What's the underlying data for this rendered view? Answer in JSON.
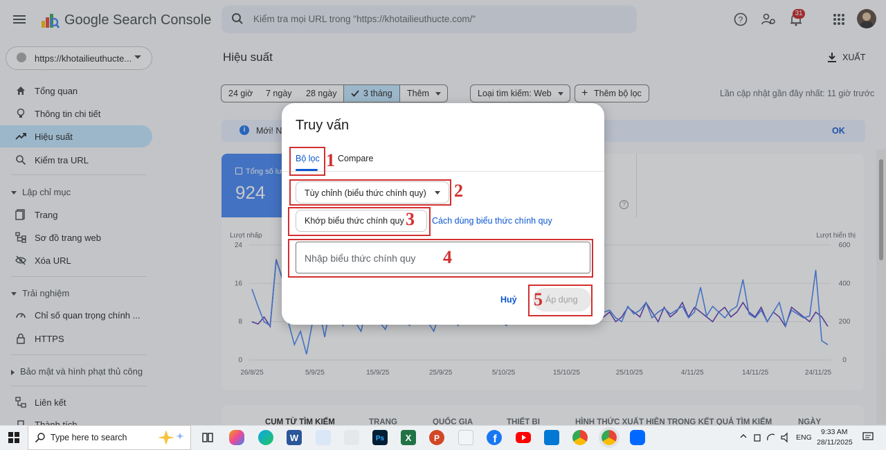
{
  "header": {
    "app_title": "Google Search Console",
    "search_placeholder": "Kiểm tra mọi URL trong \"https://khotailieuthucte.com/\"",
    "notifications_count": "31"
  },
  "sidebar": {
    "property": "https://khotailieuthucte...",
    "items_top": [
      {
        "label": "Tổng quan",
        "icon": "home-icon"
      },
      {
        "label": "Thông tin chi tiết",
        "icon": "lightbulb-icon"
      },
      {
        "label": "Hiệu suất",
        "icon": "trend-icon",
        "active": true
      },
      {
        "label": "Kiểm tra URL",
        "icon": "search-icon"
      }
    ],
    "section_index": "Lập chỉ mục",
    "items_index": [
      {
        "label": "Trang",
        "icon": "pages-icon"
      },
      {
        "label": "Sơ đồ trang web",
        "icon": "sitemap-icon"
      },
      {
        "label": "Xóa URL",
        "icon": "eye-off-icon"
      }
    ],
    "section_experience": "Trải nghiệm",
    "items_experience": [
      {
        "label": "Chỉ số quan trọng chính ...",
        "icon": "gauge-icon"
      },
      {
        "label": "HTTPS",
        "icon": "lock-icon"
      }
    ],
    "section_security": "Bảo mật và hình phạt thủ công",
    "items_links": [
      {
        "label": "Liên kết",
        "icon": "link-icon"
      },
      {
        "label": "Thành tích",
        "icon": "trophy-icon"
      }
    ]
  },
  "main": {
    "title": "Hiệu suất",
    "export_label": "XUẤT",
    "chips": [
      "24 giờ",
      "7 ngày",
      "28 ngày",
      "3 tháng",
      "Thêm",
      "Loại tìm kiếm: Web",
      "Thêm bộ lọc"
    ],
    "last_update": "Lần cập nhật gần đây nhất: 11 giờ trước",
    "banner_text": "Mới! N",
    "banner_ok": "OK",
    "metric_clicks_label": "Tổng số lư",
    "metric_clicks_value": "924",
    "table_tabs": [
      "CỤM TỪ TÌM KIẾM",
      "TRANG",
      "QUỐC GIA",
      "THIẾT BỊ",
      "HÌNH THỨC XUẤT HIỆN TRONG KẾT QUẢ TÌM KIẾM",
      "NGÀY"
    ]
  },
  "chart_data": {
    "type": "line",
    "ylabel_left": "Lượt nhấp",
    "ylabel_right": "Lượt hiển thị",
    "yticks_left": [
      "24",
      "16",
      "8",
      "0"
    ],
    "yticks_right": [
      "600",
      "400",
      "200",
      "0"
    ],
    "ylim_left": [
      0,
      24
    ],
    "ylim_right": [
      0,
      600
    ],
    "xticks": [
      "26/8/25",
      "5/9/25",
      "15/9/25",
      "25/9/25",
      "5/10/25",
      "15/10/25",
      "25/10/25",
      "4/11/25",
      "14/11/25",
      "24/11/25"
    ],
    "series": [
      {
        "color": "#5e35b1",
        "axis": "left",
        "values": [
          8,
          7.5,
          9,
          7,
          21,
          17,
          16,
          9,
          10,
          13,
          11,
          8,
          10,
          12,
          9,
          11,
          8,
          10,
          13,
          9,
          11,
          12,
          10,
          8,
          12,
          9,
          11,
          10,
          8,
          12,
          10,
          13,
          9,
          11,
          8,
          10,
          12,
          9,
          10,
          11,
          8,
          12,
          10,
          9,
          11,
          10,
          8,
          9,
          12,
          10,
          11,
          9,
          10,
          8,
          9,
          10,
          11,
          12,
          9,
          10,
          8,
          9,
          11,
          10,
          9,
          12,
          10,
          8,
          11,
          9,
          10,
          12,
          9,
          11,
          10,
          9,
          8,
          10,
          11,
          9,
          10,
          12,
          10,
          9,
          11,
          8,
          10,
          9,
          7,
          11,
          10,
          9,
          8,
          10,
          9,
          7
        ]
      },
      {
        "color": "#4285f4",
        "axis": "right",
        "values": [
          370,
          280,
          200,
          180,
          520,
          430,
          200,
          80,
          150,
          30,
          200,
          280,
          120,
          300,
          250,
          180,
          310,
          200,
          150,
          280,
          320,
          200,
          160,
          250,
          330,
          220,
          180,
          260,
          300,
          200,
          150,
          250,
          280,
          220,
          180,
          260,
          320,
          240,
          200,
          280,
          250,
          200,
          180,
          260,
          300,
          220,
          200,
          240,
          260,
          210,
          190,
          250,
          280,
          220,
          200,
          240,
          270,
          230,
          250,
          260,
          220,
          200,
          280,
          240,
          260,
          300,
          220,
          250,
          270,
          240,
          260,
          280,
          220,
          250,
          380,
          230,
          280,
          250,
          220,
          260,
          280,
          420,
          240,
          220,
          260,
          200,
          250,
          300,
          180,
          260,
          240,
          220,
          230,
          470,
          100,
          80
        ]
      }
    ]
  },
  "dialog": {
    "title": "Truy vấn",
    "tab_filter": "Bộ lọc",
    "tab_compare": "Compare",
    "filter_select": "Tùy chỉnh (biểu thức chính quy)",
    "match_button": "Khớp biểu thức chính quy",
    "regex_help_link": "Cách dùng biểu thức chính quy",
    "regex_placeholder": "Nhập biểu thức chính quy",
    "cancel": "Huỷ",
    "apply": "Áp dụng"
  },
  "annotations": [
    "1",
    "2",
    "3",
    "4",
    "5"
  ],
  "taskbar": {
    "search_text": "Type here to search",
    "language": "ENG",
    "time": "9:33 AM",
    "date": "28/11/2025",
    "apps": [
      "copilot-icon",
      "task-view-icon",
      "colorful-app-icon",
      "edge-icon",
      "word-icon",
      "pen-app-icon",
      "notepad-icon",
      "photoshop-icon",
      "excel-icon",
      "powerpoint-icon",
      "pdf-icon",
      "facebook-icon",
      "youtube-icon",
      "vscode-icon",
      "chrome-icon",
      "chrome-profile-icon",
      "zalo-icon"
    ]
  }
}
